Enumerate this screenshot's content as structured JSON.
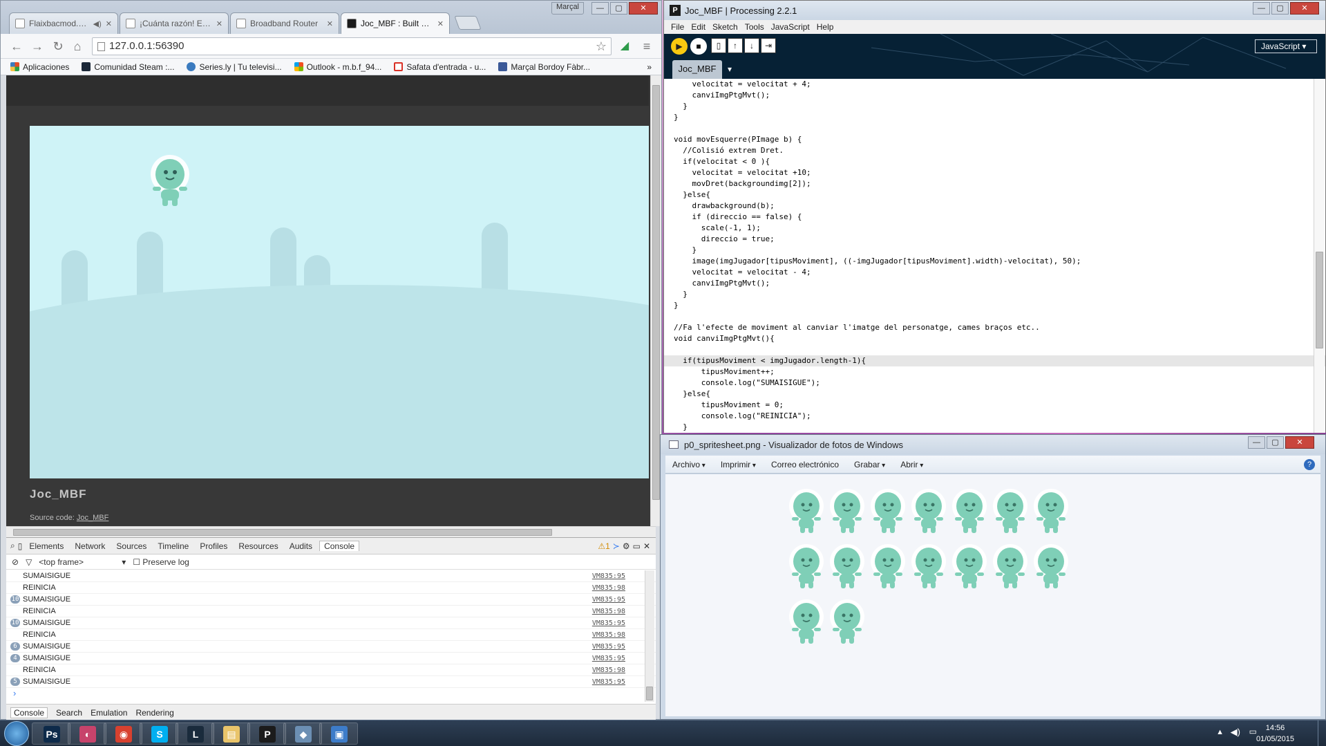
{
  "chrome": {
    "tabs": [
      {
        "title": "Flaixbacmod.html"
      },
      {
        "title": "¡Cuánta razón! Era necesa"
      },
      {
        "title": "Broadband Router"
      },
      {
        "title": "Joc_MBF : Built with Proce"
      }
    ],
    "user": "Marçal",
    "url": "127.0.0.1:56390",
    "bookmarks": [
      {
        "label": "Aplicaciones",
        "color": "#e44d26"
      },
      {
        "label": "Comunidad Steam :...",
        "color": "#1b2838"
      },
      {
        "label": "Series.ly | Tu televisi...",
        "color": "#3b7bbf"
      },
      {
        "label": "Outlook - m.b.f_94...",
        "color": "#f25022"
      },
      {
        "label": "Safata d'entrada - u...",
        "color": "#d93025"
      },
      {
        "label": "Marçal Bordoy Fàbr...",
        "color": "#3b5998"
      }
    ],
    "page": {
      "title": "Joc_MBF",
      "source_label": "Source code:",
      "source_link": "Joc_MBF"
    },
    "devtools": {
      "tabs": [
        "Elements",
        "Network",
        "Sources",
        "Timeline",
        "Profiles",
        "Resources",
        "Audits",
        "Console"
      ],
      "warnings": "1",
      "frame": "<top frame>",
      "preserve_log": "Preserve log",
      "logs": [
        {
          "count": "",
          "msg": "SUMAISIGUE",
          "src": "VM835:95"
        },
        {
          "count": "",
          "msg": "REINICIA",
          "src": "VM835:98"
        },
        {
          "count": "10",
          "msg": "SUMAISIGUE",
          "src": "VM835:95"
        },
        {
          "count": "",
          "msg": "REINICIA",
          "src": "VM835:98"
        },
        {
          "count": "10",
          "msg": "SUMAISIGUE",
          "src": "VM835:95"
        },
        {
          "count": "",
          "msg": "REINICIA",
          "src": "VM835:98"
        },
        {
          "count": "6",
          "msg": "SUMAISIGUE",
          "src": "VM835:95"
        },
        {
          "count": "4",
          "msg": "SUMAISIGUE",
          "src": "VM835:95"
        },
        {
          "count": "",
          "msg": "REINICIA",
          "src": "VM835:98"
        },
        {
          "count": "5",
          "msg": "SUMAISIGUE",
          "src": "VM835:95"
        }
      ],
      "drawer_tabs": [
        "Console",
        "Search",
        "Emulation",
        "Rendering"
      ]
    }
  },
  "processing": {
    "title": "Joc_MBF | Processing 2.2.1",
    "menus": [
      "File",
      "Edit",
      "Sketch",
      "Tools",
      "JavaScript",
      "Help"
    ],
    "mode": "JavaScript",
    "tab": "Joc_MBF",
    "code": [
      "    velocitat = velocitat + 4;",
      "    canviImgPtgMvt();",
      "  }",
      "}",
      "",
      "void movEsquerre(PImage b) {",
      "  //Colisió extrem Dret.",
      "  if(velocitat < 0 ){",
      "    velocitat = velocitat +10;",
      "    movDret(backgroundimg[2]);",
      "  }else{",
      "    drawbackground(b);",
      "    if (direccio == false) {",
      "      scale(-1, 1);",
      "      direccio = true;",
      "    }",
      "    image(imgJugador[tipusMoviment], ((-imgJugador[tipusMoviment].width)-velocitat), 50);",
      "    velocitat = velocitat - 4;",
      "    canviImgPtgMvt();",
      "  }",
      "}",
      "",
      "//Fa l'efecte de moviment al canviar l'imatge del personatge, cames braços etc..",
      "void canviImgPtgMvt(){",
      "",
      "  if(tipusMoviment < imgJugador.length-1){",
      "      tipusMoviment++;",
      "      console.log(\"SUMAISIGUE\");",
      "  }else{",
      "      tipusMoviment = 0;",
      "      console.log(\"REINICIA\");",
      "  }"
    ]
  },
  "viewer": {
    "title": "p0_spritesheet.png - Visualizador de fotos de Windows",
    "menus": [
      "Archivo",
      "Imprimir",
      "Correo electrónico",
      "Grabar",
      "Abrir"
    ]
  },
  "taskbar": {
    "apps": [
      {
        "name": "photoshop",
        "glyph": "Ps",
        "color": "#0d2a4a"
      },
      {
        "name": "paint",
        "glyph": "◐",
        "color": "#c7436b"
      },
      {
        "name": "chrome",
        "glyph": "◉",
        "color": "#d8412f"
      },
      {
        "name": "skype",
        "glyph": "S",
        "color": "#00aff0"
      },
      {
        "name": "league",
        "glyph": "L",
        "color": "#1a2b3c"
      },
      {
        "name": "explorer",
        "glyph": "▤",
        "color": "#e9c46a"
      },
      {
        "name": "processing",
        "glyph": "P",
        "color": "#1b1b1b"
      },
      {
        "name": "notepad",
        "glyph": "◆",
        "color": "#6c8fb3"
      },
      {
        "name": "photo-viewer",
        "glyph": "▣",
        "color": "#3d7cc9"
      }
    ],
    "time": "14:56",
    "date": "01/05/2015"
  },
  "colors": {
    "alien": "#7fcfb7",
    "sky": "#cff3f7"
  }
}
